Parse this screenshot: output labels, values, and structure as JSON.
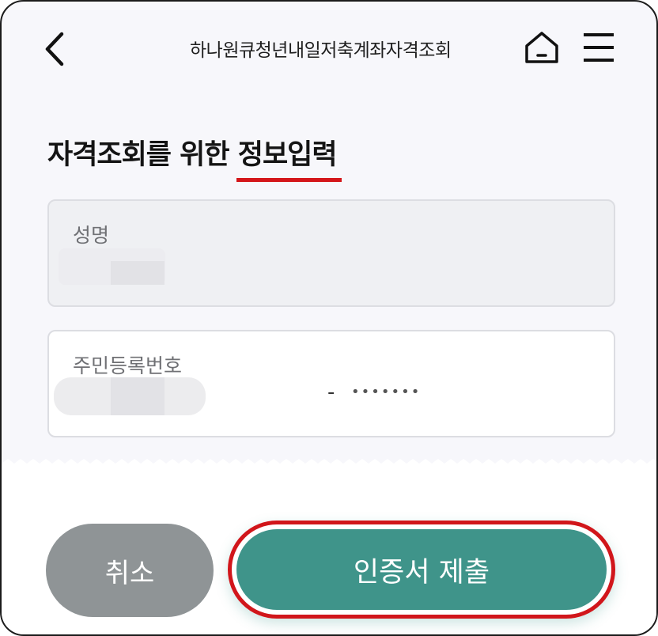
{
  "header": {
    "title": "하나원큐청년내일저축계좌자격조회",
    "back_icon": "chevron-left-icon",
    "home_icon": "home-icon",
    "menu_icon": "hamburger-menu-icon"
  },
  "main": {
    "heading_plain": "자격조회를 위한 ",
    "heading_highlight": "정보입력",
    "highlight_color": "#d4161a",
    "fields": {
      "name": {
        "label": "성명",
        "value": "",
        "disabled": true
      },
      "rrn": {
        "label": "주민등록번호",
        "front_value": "",
        "separator": "-",
        "back_masked": "•••••••"
      }
    }
  },
  "footer": {
    "cancel_label": "취소",
    "submit_label": "인증서 제출",
    "cancel_color": "#8f9496",
    "submit_color": "#3f948a",
    "submit_outline_color": "#d1161b"
  }
}
